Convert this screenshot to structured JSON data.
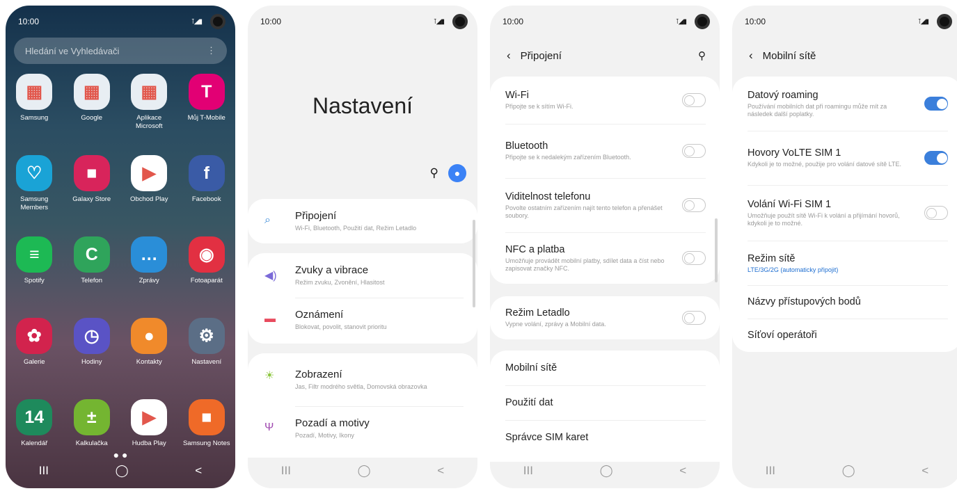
{
  "status_time": "10:00",
  "status_icons": "⊺◢▮",
  "nav": {
    "recents": "III",
    "home": "◯",
    "back": "<"
  },
  "home": {
    "search_placeholder": "Hledání ve Vyhledávači",
    "menu_icon": "⋮",
    "page_dots": "● ●",
    "apps": [
      {
        "label": "Samsung",
        "icon": "folder-icon",
        "color": "#e8eef3",
        "glyph": "▦"
      },
      {
        "label": "Google",
        "icon": "folder-icon",
        "color": "#e8eef3",
        "glyph": "▦"
      },
      {
        "label": "Aplikace Microsoft",
        "icon": "folder-icon",
        "color": "#e8eef3",
        "glyph": "▦"
      },
      {
        "label": "Můj T-Mobile",
        "icon": "t-mobile-icon",
        "color": "#e20074",
        "glyph": "T"
      },
      {
        "label": "Samsung Members",
        "icon": "members-icon",
        "color": "#1aa3d6",
        "glyph": "♡"
      },
      {
        "label": "Galaxy Store",
        "icon": "galaxy-store-icon",
        "color": "#d8245b",
        "glyph": "■"
      },
      {
        "label": "Obchod Play",
        "icon": "play-store-icon",
        "color": "#ffffff",
        "glyph": "▶"
      },
      {
        "label": "Facebook",
        "icon": "facebook-icon",
        "color": "#3a5ba6",
        "glyph": "f"
      },
      {
        "label": "Spotify",
        "icon": "spotify-icon",
        "color": "#1db954",
        "glyph": "≡"
      },
      {
        "label": "Telefon",
        "icon": "phone-icon",
        "color": "#2fa45b",
        "glyph": "C"
      },
      {
        "label": "Zprávy",
        "icon": "messages-icon",
        "color": "#2a8ed8",
        "glyph": "…"
      },
      {
        "label": "Fotoaparát",
        "icon": "camera-icon",
        "color": "#e23042",
        "glyph": "◉"
      },
      {
        "label": "Galerie",
        "icon": "gallery-icon",
        "color": "#d2234d",
        "glyph": "✿"
      },
      {
        "label": "Hodiny",
        "icon": "clock-icon",
        "color": "#5a53c5",
        "glyph": "◷"
      },
      {
        "label": "Kontakty",
        "icon": "contacts-icon",
        "color": "#f08a2b",
        "glyph": "●"
      },
      {
        "label": "Nastavení",
        "icon": "settings-icon",
        "color": "#5b6e86",
        "glyph": "⚙"
      },
      {
        "label": "Kalendář",
        "icon": "calendar-icon",
        "color": "#1e8a5c",
        "glyph": "14"
      },
      {
        "label": "Kalkulačka",
        "icon": "calculator-icon",
        "color": "#74b531",
        "glyph": "±"
      },
      {
        "label": "Hudba Play",
        "icon": "play-music-icon",
        "color": "#ffffff",
        "glyph": "▶"
      },
      {
        "label": "Samsung Notes",
        "icon": "notes-icon",
        "color": "#ef6a28",
        "glyph": "■"
      }
    ]
  },
  "settings": {
    "title": "Nastavení",
    "groups": [
      [
        {
          "title": "Připojení",
          "sub": "Wi-Fi, Bluetooth, Použití dat, Režim Letadlo",
          "icon": "wifi-icon",
          "glyph": "⌕",
          "color": "#3b8ad8"
        }
      ],
      [
        {
          "title": "Zvuky a vibrace",
          "sub": "Režim zvuku, Zvonění, Hlasitost",
          "icon": "sound-icon",
          "glyph": "◀)",
          "color": "#7b6ad8"
        },
        {
          "title": "Oznámení",
          "sub": "Blokovat, povolit, stanovit prioritu",
          "icon": "notifications-icon",
          "glyph": "▬",
          "color": "#e84b5e"
        }
      ],
      [
        {
          "title": "Zobrazení",
          "sub": "Jas, Filtr modrého světla, Domovská obrazovka",
          "icon": "display-icon",
          "glyph": "☀",
          "color": "#8cc63e"
        },
        {
          "title": "Pozadí a motivy",
          "sub": "Pozadí, Motivy, Ikony",
          "icon": "themes-icon",
          "glyph": "Ψ",
          "color": "#a04ab0"
        }
      ]
    ]
  },
  "connections": {
    "title": "Připojení",
    "group1": [
      {
        "title": "Wi-Fi",
        "sub": "Připojte se k sítím Wi-Fi.",
        "on": false
      },
      {
        "title": "Bluetooth",
        "sub": "Připojte se k nedalekým zařízením Bluetooth.",
        "on": false
      },
      {
        "title": "Viditelnost telefonu",
        "sub": "Povolte ostatním zařízením najít tento telefon a přenášet soubory.",
        "on": false
      },
      {
        "title": "NFC a platba",
        "sub": "Umožňuje provádět mobilní platby, sdílet data a číst nebo zapisovat značky NFC.",
        "on": false
      }
    ],
    "group2": [
      {
        "title": "Režim Letadlo",
        "sub": "Vypne volání, zprávy a Mobilní data.",
        "on": false
      }
    ],
    "group3": [
      "Mobilní sítě",
      "Použití dat",
      "Správce SIM karet"
    ]
  },
  "mobile": {
    "title": "Mobilní sítě",
    "toggles": [
      {
        "title": "Datový roaming",
        "sub": "Používání mobilních dat při roamingu může mít za následek další poplatky.",
        "on": true
      },
      {
        "title": "Hovory VoLTE SIM 1",
        "sub": "Kdykoli je to možné, použije pro volání datové sítě LTE.",
        "on": true
      },
      {
        "title": "Volání Wi-Fi SIM 1",
        "sub": "Umožňuje použít sítě Wi-Fi k volání a přijímání hovorů, kdykoli je to možné.",
        "on": false
      }
    ],
    "network_mode": {
      "title": "Režim sítě",
      "value": "LTE/3G/2G (automaticky připojit)"
    },
    "items": [
      "Názvy přístupových bodů",
      "Síťoví operátoři"
    ]
  }
}
